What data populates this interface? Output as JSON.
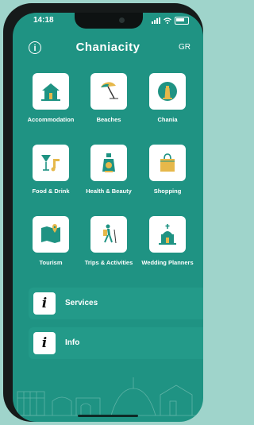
{
  "status": {
    "time": "14:18"
  },
  "header": {
    "title": "Chaniacity",
    "lang": "GR",
    "info_glyph": "i"
  },
  "tiles": [
    {
      "label": "Accommodation",
      "icon": "house-icon"
    },
    {
      "label": "Beaches",
      "icon": "umbrella-icon"
    },
    {
      "label": "Chania",
      "icon": "lighthouse-icon"
    },
    {
      "label": "Food & Drink",
      "icon": "drinks-icon"
    },
    {
      "label": "Health & Beauty",
      "icon": "perfume-icon"
    },
    {
      "label": "Shopping",
      "icon": "shopping-bag-icon"
    },
    {
      "label": "Tourism",
      "icon": "map-icon"
    },
    {
      "label": "Trips & Activities",
      "icon": "hiker-icon"
    },
    {
      "label": "Wedding Planners",
      "icon": "chapel-icon"
    }
  ],
  "list": [
    {
      "label": "Services",
      "glyph": "i"
    },
    {
      "label": "Info",
      "glyph": "i"
    }
  ],
  "colors": {
    "background": "#1f9383",
    "accent": "#e6b84a",
    "teal": "#1f9383"
  }
}
